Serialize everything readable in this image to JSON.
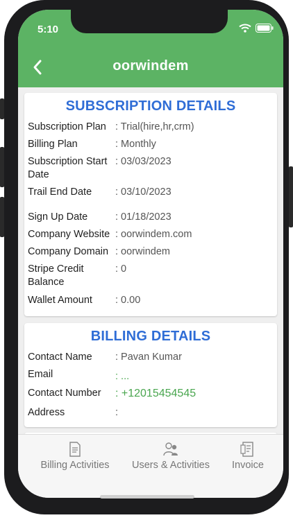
{
  "status": {
    "time": "5:10"
  },
  "header": {
    "title": "oorwindem"
  },
  "subscription": {
    "title": "SUBSCRIPTION DETAILS",
    "rows": [
      {
        "label": "Subscription Plan",
        "value": ": Trial(hire,hr,crm)"
      },
      {
        "label": "Billing Plan",
        "value": ": Monthly"
      },
      {
        "label": "Subscription Start Date",
        "value": ": 03/03/2023"
      },
      {
        "label": "Trail End Date",
        "value": ": 03/10/2023"
      },
      {
        "label": "Sign Up Date",
        "value": ": 01/18/2023"
      },
      {
        "label": "Company Website",
        "value": ": oorwindem.com"
      },
      {
        "label": "Company Domain",
        "value": ": oorwindem"
      },
      {
        "label": "Stripe Credit Balance",
        "value": ": 0"
      },
      {
        "label": "Wallet Amount",
        "value": ": 0.00"
      }
    ]
  },
  "billing": {
    "title": "BILLING DETAILS",
    "rows": [
      {
        "label": "Contact Name",
        "value": ": Pavan Kumar"
      },
      {
        "label": "Email",
        "value": ": ..."
      },
      {
        "label": "Contact Number",
        "value": ": +12015454545"
      },
      {
        "label": "Address",
        "value": ":"
      }
    ]
  },
  "tabs": [
    {
      "label": "Billing Activities",
      "icon": "document-icon"
    },
    {
      "label": "Users & Activities",
      "icon": "users-icon"
    },
    {
      "label": "Invoice",
      "icon": "invoice-icon"
    }
  ],
  "colors": {
    "appbar": "#5cb364",
    "title_blue": "#2f6dd6",
    "link_green": "#4aa64f"
  }
}
